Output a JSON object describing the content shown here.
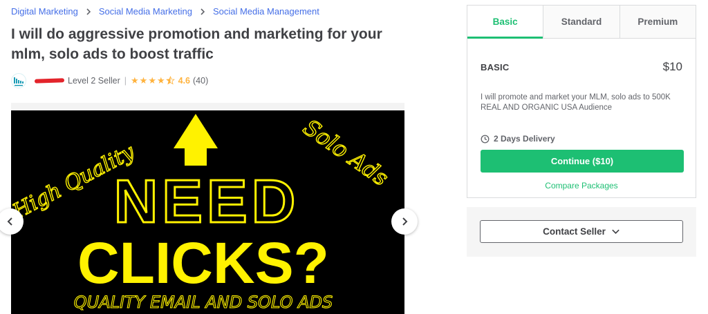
{
  "breadcrumb": [
    "Digital Marketing",
    "Social Media Marketing",
    "Social Media Management"
  ],
  "gig": {
    "title": "I will do aggressive promotion and marketing for your mlm, solo ads to boost traffic"
  },
  "seller": {
    "level": "Level 2 Seller",
    "rating": "4.6",
    "reviews": "(40)",
    "star_count": 4.5
  },
  "gallery": {
    "image_text": {
      "high_quality": "High Quality",
      "solo_ads": "Solo Ads",
      "need": "NEED",
      "clicks": "CLICKS?",
      "subline": "QUALITY EMAIL AND SOLO ADS"
    }
  },
  "package": {
    "tabs": [
      "Basic",
      "Standard",
      "Premium"
    ],
    "active_tab": 0,
    "name": "BASIC",
    "price": "$10",
    "description": "I will promote and market your MLM, solo ads to 500K REAL AND ORGANIC USA Audience",
    "delivery": "2 Days Delivery",
    "continue_label": "Continue ($10)",
    "compare_label": "Compare Packages"
  },
  "contact": {
    "label": "Contact Seller"
  },
  "colors": {
    "brand_green": "#1dbf73",
    "link_blue": "#446ee7",
    "star_gold": "#ffb33e",
    "image_yellow": "#fff200"
  },
  "icons": [
    "chevron-right-icon",
    "star-icon",
    "half-star-icon",
    "clock-icon",
    "chevron-down-icon",
    "chevron-left-icon",
    "seller-logo-icon"
  ]
}
